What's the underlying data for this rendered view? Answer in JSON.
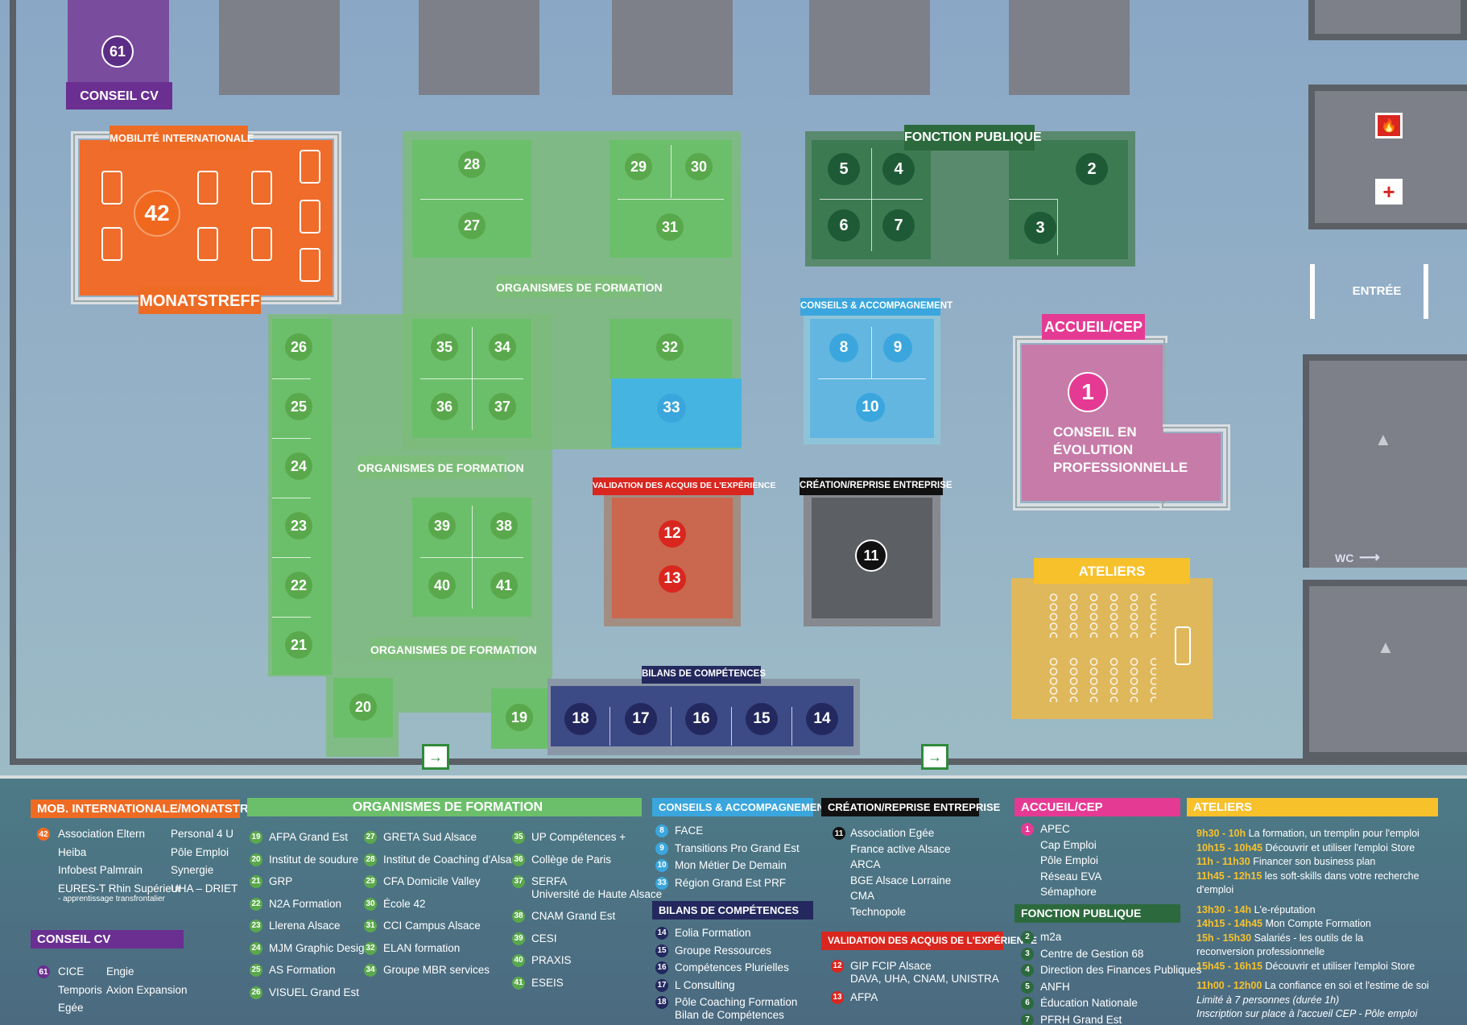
{
  "map": {
    "stand_61": {
      "number": "61",
      "label": "CONSEIL CV"
    },
    "mobilite": {
      "header": "MOBILITÉ INTERNATIONALE",
      "number": "42",
      "footer": "MONATSTREFF"
    },
    "formation_labels": [
      "ORGANISMES DE FORMATION",
      "ORGANISMES DE FORMATION",
      "ORGANISMES DE FORMATION"
    ],
    "green_stands": [
      "28",
      "27",
      "29",
      "30",
      "31",
      "26",
      "25",
      "24",
      "23",
      "22",
      "21",
      "35",
      "34",
      "36",
      "37",
      "39",
      "38",
      "40",
      "41",
      "32",
      "20",
      "19"
    ],
    "fonction_publique": {
      "label": "FONCTION PUBLIQUE",
      "stands": [
        "5",
        "4",
        "6",
        "7",
        "2",
        "3"
      ]
    },
    "conseils": {
      "label": "CONSEILS & ACCOMPAGNEMENT",
      "stands": [
        "8",
        "9",
        "10",
        "33"
      ]
    },
    "vae": {
      "label": "VALIDATION DES ACQUIS DE L'EXPÉRIENCE",
      "stands": [
        "12",
        "13"
      ]
    },
    "creation": {
      "label": "CRÉATION/REPRISE ENTREPRISE",
      "stand": "11"
    },
    "accueil": {
      "label": "ACCUEIL/CEP",
      "number": "1",
      "text": [
        "CONSEIL EN",
        "ÉVOLUTION",
        "PROFESSIONNELLE"
      ]
    },
    "ateliers": {
      "label": "ATELIERS"
    },
    "bilans": {
      "label": "BILANS DE COMPÉTENCES",
      "stands": [
        "18",
        "17",
        "16",
        "15",
        "14"
      ]
    },
    "entree": "ENTRÉE",
    "wc": "WC",
    "icons": [
      "fire-extinguisher-icon",
      "first-aid-icon",
      "emergency-exit-icon",
      "restroom-icon"
    ]
  },
  "legend": {
    "mob": {
      "title": "MOB. INTERNATIONALE/MONATSTREFF",
      "num": "42",
      "col1": [
        "Association Eltern",
        "Heiba",
        "Infobest Palmrain",
        "EURES-T Rhin Supérieur",
        "- apprentissage transfrontalier"
      ],
      "col2": [
        "Personal 4 U",
        "Pôle Emploi",
        "Synergie",
        "UHA – DRIET"
      ]
    },
    "cv": {
      "title": "CONSEIL CV",
      "num": "61",
      "col1": [
        "CICE",
        "Temporis",
        "Egée"
      ],
      "col2": [
        "Engie",
        "Axion Expansion"
      ]
    },
    "formation": {
      "title": "ORGANISMES DE FORMATION",
      "col1": [
        [
          "19",
          "AFPA Grand Est"
        ],
        [
          "20",
          "Institut de soudure"
        ],
        [
          "21",
          "GRP"
        ],
        [
          "22",
          "N2A Formation"
        ],
        [
          "23",
          "Llerena Alsace"
        ],
        [
          "24",
          "MJM Graphic Design"
        ],
        [
          "25",
          "AS Formation"
        ],
        [
          "26",
          "VISUEL Grand Est"
        ]
      ],
      "col2": [
        [
          "27",
          "GRETA Sud Alsace"
        ],
        [
          "28",
          "Institut de Coaching d'Alsace"
        ],
        [
          "29",
          "CFA Domicile Valley"
        ],
        [
          "30",
          "École 42"
        ],
        [
          "31",
          "CCI Campus Alsace"
        ],
        [
          "32",
          "ELAN formation"
        ],
        [
          "34",
          "Groupe MBR services"
        ]
      ],
      "col3": [
        [
          "35",
          "UP Compétences +"
        ],
        [
          "36",
          "Collège de Paris"
        ],
        [
          "37",
          "SERFA"
        ],
        [
          "38",
          "CNAM Grand Est"
        ],
        [
          "39",
          "CESI"
        ],
        [
          "40",
          "PRAXIS"
        ],
        [
          "41",
          "ESEIS"
        ]
      ],
      "serfa_sub": "Université de Haute Alsace"
    },
    "conseils": {
      "title": "CONSEILS & ACCOMPAGNEMENT",
      "items": [
        [
          "8",
          "FACE"
        ],
        [
          "9",
          "Transitions Pro Grand Est"
        ],
        [
          "10",
          "Mon Métier De Demain"
        ],
        [
          "33",
          "Région Grand Est PRF"
        ]
      ]
    },
    "bilans": {
      "title": "BILANS DE COMPÉTENCES",
      "items": [
        [
          "14",
          "Eolia Formation"
        ],
        [
          "15",
          "Groupe Ressources"
        ],
        [
          "16",
          "Compétences Plurielles"
        ],
        [
          "17",
          "L Consulting"
        ],
        [
          "18",
          "Pôle Coaching Formation"
        ]
      ],
      "sub": "Bilan de Compétences"
    },
    "creation": {
      "title": "CRÉATION/REPRISE ENTREPRISE",
      "num": "11",
      "items": [
        "Association Egée",
        "France active Alsace",
        "ARCA",
        "BGE Alsace Lorraine",
        "CMA",
        "Technopole"
      ]
    },
    "vae": {
      "title": "VALIDATION DES ACQUIS DE L'EXPÉRIENCE",
      "items": [
        [
          "12",
          "GIP FCIP Alsace"
        ],
        [
          "13",
          "AFPA"
        ]
      ],
      "sub": "DAVA, UHA, CNAM, UNISTRA"
    },
    "accueil": {
      "title": "ACCUEIL/CEP",
      "num": "1",
      "items": [
        "APEC",
        "Cap Emploi",
        "Pôle Emploi",
        "Réseau EVA",
        "Sémaphore"
      ]
    },
    "fp": {
      "title": "FONCTION PUBLIQUE",
      "items": [
        [
          "2",
          "m2a"
        ],
        [
          "3",
          "Centre de Gestion 68"
        ],
        [
          "4",
          "Direction des Finances Publiques"
        ],
        [
          "5",
          "ANFH"
        ],
        [
          "6",
          "Éducation Nationale"
        ],
        [
          "7",
          "PFRH Grand Est"
        ]
      ]
    },
    "ateliers": {
      "title": "ATELIERS",
      "rows": [
        [
          "9h30 - 10h",
          " La formation, un tremplin pour l'emploi"
        ],
        [
          "10h15 - 10h45",
          " Découvrir et utiliser l'emploi Store"
        ],
        [
          "11h - 11h30",
          " Financer son business plan"
        ],
        [
          "11h45 - 12h15",
          " les soft-skills dans votre recherche"
        ],
        [
          "",
          "d'emploi"
        ],
        [
          "13h30 - 14h",
          " L'e-réputation"
        ],
        [
          "14h15 - 14h45",
          " Mon Compte Formation"
        ],
        [
          "15h - 15h30",
          " Salariés - les outils de la"
        ],
        [
          "",
          "reconversion professionnelle"
        ],
        [
          "15h45 - 16h15",
          " Découvrir et utiliser l'emploi Store"
        ],
        [
          "11h00 - 12h00",
          " La confiance en soi et l'estime de soi"
        ]
      ],
      "note1": "Limité à 7 personnes (durée 1h)",
      "note2": "Inscription sur place à l'accueil CEP - Pôle emploi"
    }
  }
}
